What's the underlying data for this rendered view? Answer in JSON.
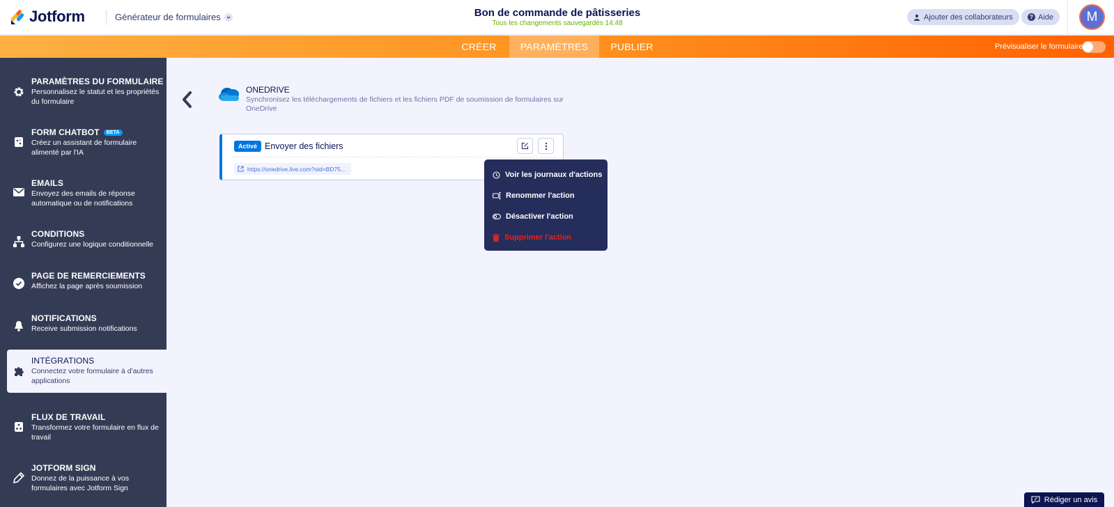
{
  "header": {
    "logo_text": "Jotform",
    "builder_label": "Générateur de formulaires",
    "form_title": "Bon de commande de pâtisseries",
    "save_status": "Tous les changements sauvegardés 14:48",
    "collab_label": "Ajouter des collaborateurs",
    "help_label": "Aide",
    "avatar_initial": "M"
  },
  "nav": {
    "tabs": [
      {
        "label": "CRÉER",
        "active": false
      },
      {
        "label": "PARAMÈTRES",
        "active": true
      },
      {
        "label": "PUBLIER",
        "active": false
      }
    ],
    "preview_label": "Prévisualiser le formulaire"
  },
  "sidebar": {
    "items": [
      {
        "title": "PARAMÈTRES DU FORMULAIRE",
        "desc": "Personnalisez le statut et les propriétés du formulaire",
        "icon": "gear-icon"
      },
      {
        "title": "FORM CHATBOT",
        "badge": "BETA",
        "desc": "Créez un assistant de formulaire alimenté par l'IA",
        "icon": "chatbot-icon"
      },
      {
        "title": "EMAILS",
        "desc": "Envoyez des emails de réponse automatique ou de notifications",
        "icon": "envelope-icon"
      },
      {
        "title": "CONDITIONS",
        "desc": "Configurez une logique conditionnelle",
        "icon": "hierarchy-icon"
      },
      {
        "title": "PAGE DE REMERCIEMENTS",
        "desc": "Affichez la page après soumission",
        "icon": "check-circle-icon"
      },
      {
        "title": "NOTIFICATIONS",
        "desc": "Receive submission notifications",
        "icon": "bell-icon"
      },
      {
        "title": "INTÉGRATIONS",
        "desc": "Connectez votre formulaire à d'autres applications",
        "icon": "puzzle-icon"
      },
      {
        "title": "FLUX DE TRAVAIL",
        "desc": "Transformez votre formulaire en flux de travail",
        "icon": "workflow-icon"
      },
      {
        "title": "JOTFORM SIGN",
        "desc": "Donnez de la puissance à vos formulaires avec Jotform Sign",
        "icon": "pen-icon"
      }
    ]
  },
  "integration": {
    "name": "ONEDRIVE",
    "description": "Synchronisez les téléchargements de fichiers et les fichiers PDF de soumission de formulaires sur OneDrive",
    "action": {
      "status": "Activé",
      "title": "Envoyer des fichiers",
      "url": "https://onedrive.live.com?oid=BD75..."
    }
  },
  "action_menu": {
    "items": [
      {
        "label": "Voir les journaux d'actions",
        "icon": "history-icon"
      },
      {
        "label": "Renommer l'action",
        "icon": "rename-icon"
      },
      {
        "label": "Désactiver l'action",
        "icon": "toggle-off-icon"
      },
      {
        "label": "Supprimer l'action",
        "icon": "trash-icon",
        "danger": true
      }
    ]
  },
  "feedback": {
    "label": "Rédiger un avis"
  },
  "colors": {
    "brand_navy": "#0a1551",
    "sidebar_bg": "#343c55",
    "accent_orange": "#ff6100",
    "status_blue": "#0075e3",
    "danger_red": "#dc2626"
  }
}
